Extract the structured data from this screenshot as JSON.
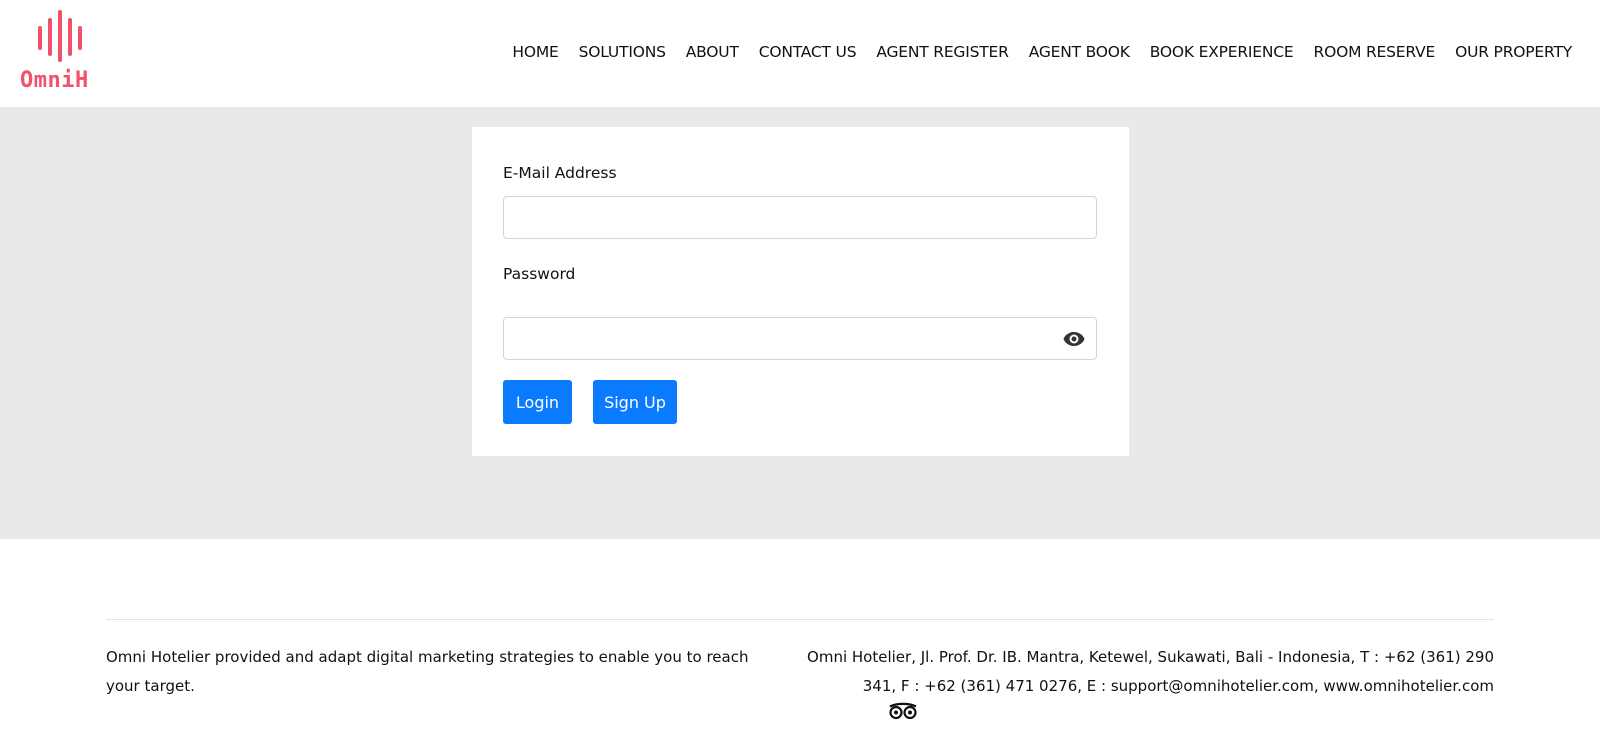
{
  "brand": {
    "logo_text": "OmniH",
    "color": "#f0516b"
  },
  "nav": {
    "items": [
      {
        "label": "HOME"
      },
      {
        "label": "SOLUTIONS"
      },
      {
        "label": "ABOUT"
      },
      {
        "label": "CONTACT US"
      },
      {
        "label": "AGENT REGISTER"
      },
      {
        "label": "AGENT BOOK"
      },
      {
        "label": "BOOK EXPERIENCE"
      },
      {
        "label": "ROOM RESERVE"
      },
      {
        "label": "OUR PROPERTY"
      }
    ]
  },
  "login_form": {
    "email_label": "E-Mail Address",
    "email_value": "",
    "password_label": "Password",
    "password_value": "",
    "password_toggle_icon": "eye-icon",
    "login_label": "Login",
    "signup_label": "Sign Up",
    "button_color": "#0a7bff"
  },
  "footer": {
    "tagline": "Omni Hotelier provided and adapt digital marketing strategies to enable you to reach your target.",
    "contact": "Omni Hotelier, Jl. Prof. Dr. IB. Mantra, Ketewel, Sukawati, Bali - Indonesia, T : +62 (361) 290 341, F : +62 (361) 471 0276, E : support@omnihotelier.com, www.omnihotelier.com",
    "social_icon": "tripadvisor-icon"
  }
}
